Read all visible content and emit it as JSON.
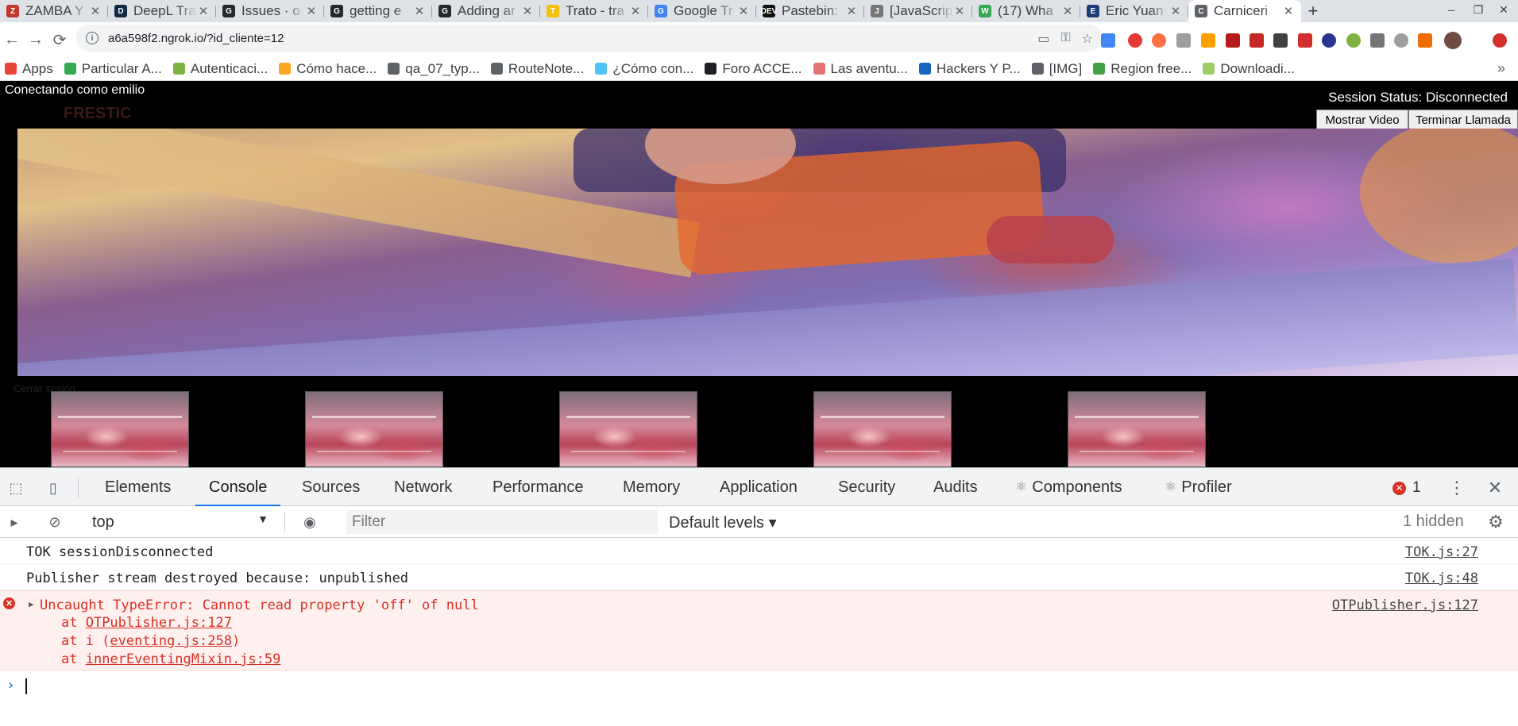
{
  "browser": {
    "tabs": [
      {
        "title": "ZAMBA Y",
        "color": "#c0392b",
        "glyph": "Z"
      },
      {
        "title": "DeepL Tra",
        "color": "#0f2b46",
        "glyph": "D"
      },
      {
        "title": "Issues · o",
        "color": "#24292e",
        "glyph": "G"
      },
      {
        "title": "getting e",
        "color": "#24292e",
        "glyph": "G"
      },
      {
        "title": "Adding ar",
        "color": "#24292e",
        "glyph": "G"
      },
      {
        "title": "Trato - tra",
        "color": "#f4c20d",
        "glyph": "T"
      },
      {
        "title": "Google Tr",
        "color": "#4285f4",
        "glyph": "G"
      },
      {
        "title": "Pastebin:",
        "color": "#111111",
        "glyph": "DEV"
      },
      {
        "title": "[JavaScrip",
        "color": "#777777",
        "glyph": "J"
      },
      {
        "title": "(17) Wha",
        "color": "#34a853",
        "glyph": "W"
      },
      {
        "title": "Eric Yuan",
        "color": "#1f3b73",
        "glyph": "E"
      },
      {
        "title": "Carniceri",
        "color": "#5f6368",
        "glyph": "C",
        "active": true
      }
    ],
    "new_tab": "+",
    "window_controls": {
      "minimize": "–",
      "restore": "❐",
      "close": "✕"
    },
    "url": "a6a598f2.ngrok.io/?id_cliente=12",
    "nav": {
      "back": "←",
      "forward": "→",
      "reload": "⟳"
    },
    "omnibox_icons": [
      "camera-off-icon",
      "key-icon",
      "star-icon"
    ],
    "bookmarks": [
      {
        "label": "Apps",
        "color": "#ea4335"
      },
      {
        "label": "Particular A...",
        "color": "#34a853"
      },
      {
        "label": "Autenticaci...",
        "color": "#7cb342"
      },
      {
        "label": "Cómo hace...",
        "color": "#f9a825"
      },
      {
        "label": "qa_07_typ...",
        "color": "#5f6368"
      },
      {
        "label": "RouteNote...",
        "color": "#5f6368"
      },
      {
        "label": "¿Cómo con...",
        "color": "#4fc3f7"
      },
      {
        "label": "Foro ACCE...",
        "color": "#202124"
      },
      {
        "label": "Las aventu...",
        "color": "#e57373"
      },
      {
        "label": "Hackers Y P...",
        "color": "#1565c0"
      },
      {
        "label": "[IMG]",
        "color": "#5f6368"
      },
      {
        "label": "Region free...",
        "color": "#43a047"
      },
      {
        "label": "Downloadi...",
        "color": "#9ccc65"
      }
    ],
    "bookmarks_more": "»"
  },
  "page": {
    "connecting_label": "Conectando como emilio",
    "logo_text": "FRESTIC",
    "session_status": "Session Status: Disconnected",
    "show_video_button": "Mostrar Video",
    "end_call_button": "Terminar Llamada",
    "logout_link": "Cerrar sesión",
    "thumbnail_count": 5
  },
  "devtools": {
    "tabs": [
      "Elements",
      "Console",
      "Sources",
      "Network",
      "Performance",
      "Memory",
      "Application",
      "Security",
      "Audits",
      "Components",
      "Profiler"
    ],
    "active_tab": "Console",
    "error_count": "1",
    "context": "top",
    "filter_placeholder": "Filter",
    "levels": "Default levels ▾",
    "hidden": "1 hidden",
    "messages": [
      {
        "text": "TOK sessionDisconnected",
        "source": "TOK.js:27"
      },
      {
        "text": "Publisher stream destroyed because: unpublished",
        "source": "TOK.js:48"
      }
    ],
    "error": {
      "text": "Uncaught TypeError: Cannot read property 'off' of null",
      "source": "OTPublisher.js:127",
      "stack": [
        {
          "prefix": "at ",
          "link": "OTPublisher.js:127",
          "suffix": ""
        },
        {
          "prefix": "at i (",
          "link": "eventing.js:258",
          "suffix": ")"
        },
        {
          "prefix": "at ",
          "link": "innerEventingMixin.js:59",
          "suffix": ""
        }
      ]
    },
    "prompt": "›"
  }
}
